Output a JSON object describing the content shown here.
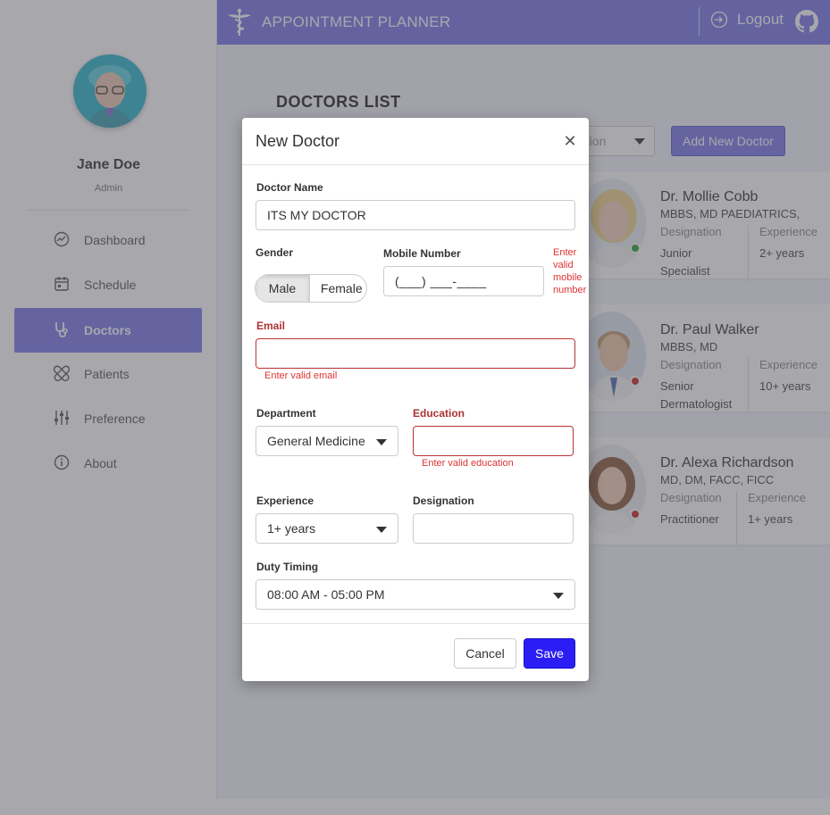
{
  "app": {
    "title": "APPOINTMENT PLANNER",
    "logout_label": "Logout"
  },
  "user": {
    "name": "Jane Doe",
    "role": "Admin"
  },
  "sidebar": {
    "items": [
      {
        "label": "Dashboard",
        "icon": "dashboard-icon"
      },
      {
        "label": "Schedule",
        "icon": "calendar-icon"
      },
      {
        "label": "Doctors",
        "icon": "stethoscope-icon",
        "active": true
      },
      {
        "label": "Patients",
        "icon": "bandage-icon"
      },
      {
        "label": "Preference",
        "icon": "sliders-icon"
      },
      {
        "label": "About",
        "icon": "info-icon"
      }
    ]
  },
  "main": {
    "title": "DOCTORS LIST",
    "filter_value": "ation",
    "add_button": "Add New Doctor",
    "doctors": [
      {
        "name": "Dr. Mollie Cobb",
        "quals": "MBBS, MD PAEDIATRICS,",
        "designation_label": "Designation",
        "designation_1": "Junior",
        "designation_2": "Specialist",
        "experience_label": "Experience",
        "experience": "2+ years",
        "status": "online",
        "status_color": "#2ba32b"
      },
      {
        "name": "Dr. Paul Walker",
        "quals": "MBBS, MD",
        "designation_label": "Designation",
        "designation_1": "Senior",
        "designation_2": "Dermatologist",
        "experience_label": "Experience",
        "experience": "10+ years",
        "status": "offline",
        "status_color": "#c62828"
      },
      {
        "name": "Dr. Alexa Richardson",
        "quals": "MD, DM, FACC, FICC",
        "designation_label": "Designation",
        "designation_1": "Practitioner",
        "designation_2": "",
        "experience_label": "Experience",
        "experience": "1+ years",
        "status": "offline",
        "status_color": "#c62828"
      }
    ]
  },
  "modal": {
    "title": "New Doctor",
    "close_icon": "close-icon",
    "doctor_name_label": "Doctor Name",
    "doctor_name_value": "ITS MY DOCTOR",
    "gender_label": "Gender",
    "gender_options": [
      "Male",
      "Female"
    ],
    "gender_selected": "Male",
    "mobile_label": "Mobile Number",
    "mobile_mask": "(___) ___-____",
    "mobile_error": [
      "Enter",
      "valid",
      "mobile",
      "number"
    ],
    "email_label": "Email",
    "email_value": "",
    "email_error": "Enter valid email",
    "department_label": "Department",
    "department_value": "General Medicine",
    "education_label": "Education",
    "education_value": "",
    "education_error": "Enter valid education",
    "experience_label": "Experience",
    "experience_value": "1+ years",
    "designation_label": "Designation",
    "designation_value": "",
    "duty_label": "Duty Timing",
    "duty_value": "08:00 AM - 05:00 PM",
    "cancel_label": "Cancel",
    "save_label": "Save"
  },
  "colors": {
    "accent": "#7876e6",
    "save": "#2b1ef5",
    "error": "#dd3333"
  }
}
